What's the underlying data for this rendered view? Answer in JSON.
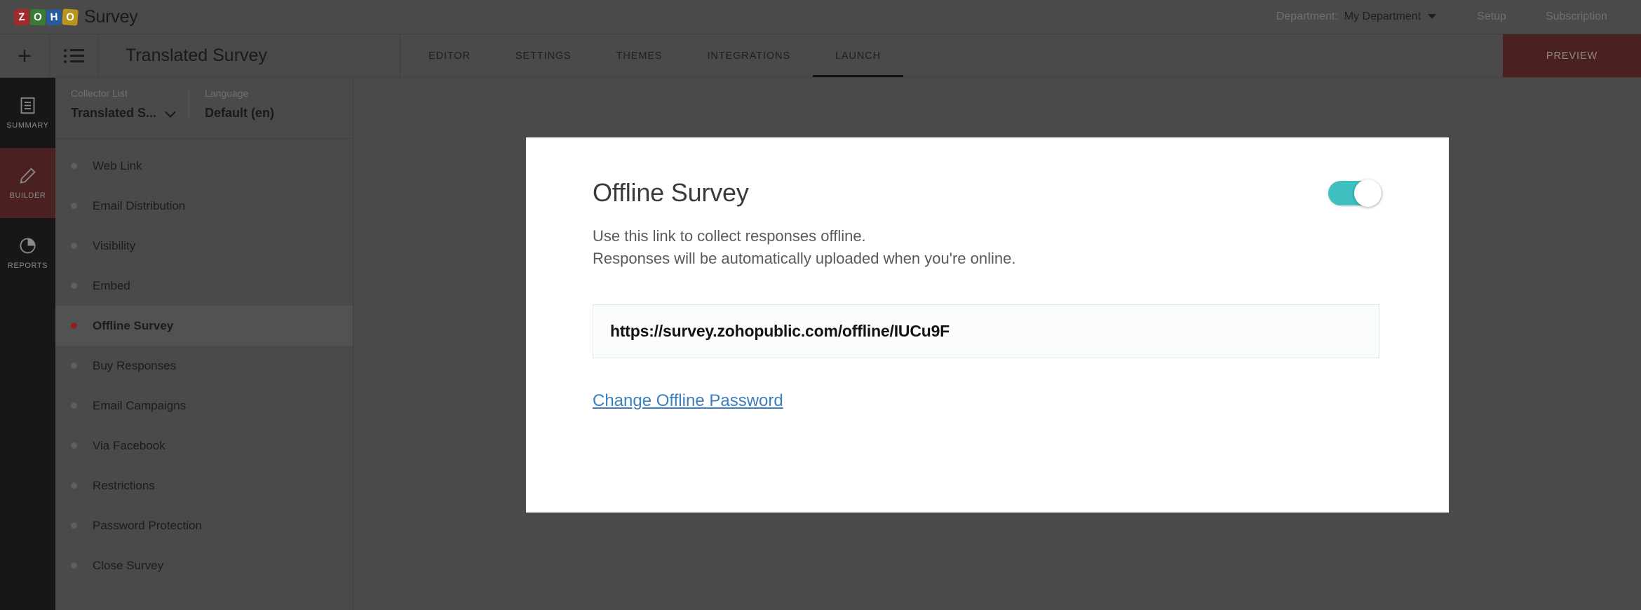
{
  "topbar": {
    "logo_letters": [
      "Z",
      "O",
      "H",
      "O"
    ],
    "brand_name": "Survey",
    "department_label": "Department:",
    "department_value": "My Department",
    "setup_label": "Setup",
    "subscription_label": "Subscription"
  },
  "subbar": {
    "add_label": "+",
    "survey_title": "Translated Survey",
    "tabs": [
      {
        "label": "EDITOR",
        "active": false
      },
      {
        "label": "SETTINGS",
        "active": false
      },
      {
        "label": "THEMES",
        "active": false
      },
      {
        "label": "INTEGRATIONS",
        "active": false
      },
      {
        "label": "LAUNCH",
        "active": true
      }
    ],
    "preview_label": "PREVIEW"
  },
  "rail": {
    "items": [
      {
        "label": "SUMMARY",
        "icon": "document-icon",
        "active": false
      },
      {
        "label": "BUILDER",
        "icon": "pencil-icon",
        "active": true
      },
      {
        "label": "REPORTS",
        "icon": "pie-chart-icon",
        "active": false
      }
    ]
  },
  "collector": {
    "collector_list_label": "Collector List",
    "collector_list_value": "Translated S...",
    "language_label": "Language",
    "language_value": "Default (en)",
    "items": [
      {
        "label": "Web Link",
        "active": false
      },
      {
        "label": "Email Distribution",
        "active": false
      },
      {
        "label": "Visibility",
        "active": false
      },
      {
        "label": "Embed",
        "active": false
      },
      {
        "label": "Offline Survey",
        "active": true
      },
      {
        "label": "Buy Responses",
        "active": false
      },
      {
        "label": "Email Campaigns",
        "active": false
      },
      {
        "label": "Via Facebook",
        "active": false
      },
      {
        "label": "Restrictions",
        "active": false
      },
      {
        "label": "Password Protection",
        "active": false
      },
      {
        "label": "Close Survey",
        "active": false
      }
    ]
  },
  "modal": {
    "title": "Offline Survey",
    "description_line1": "Use this link to collect responses offline.",
    "description_line2": "Responses will be automatically uploaded when you're online.",
    "toggle_state": "on",
    "url_value": "https://survey.zohopublic.com/offline/IUCu9F",
    "change_password_link": "Change Offline Password"
  },
  "colors": {
    "accent_teal": "#3fbfbf",
    "link_blue": "#3c7fbf",
    "active_maroon": "#4a2020",
    "bullet_red": "#8e2020",
    "chrome_gray": "#4a4a4a",
    "rail_dark": "#171717"
  }
}
